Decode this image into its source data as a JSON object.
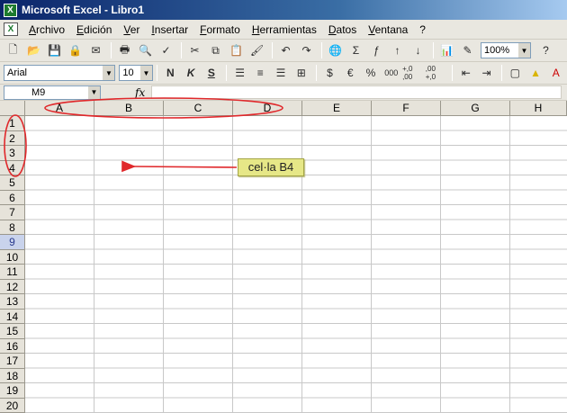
{
  "window": {
    "title": "Microsoft Excel - Libro1"
  },
  "menu": [
    "Archivo",
    "Edición",
    "Ver",
    "Insertar",
    "Formato",
    "Herramientas",
    "Datos",
    "Ventana",
    "?"
  ],
  "toolbar1": {
    "icons": [
      "new-icon",
      "open-icon",
      "save-icon",
      "permission-icon",
      "email-icon",
      "print-icon",
      "print-preview-icon",
      "spelling-icon",
      "cut-icon",
      "copy-icon",
      "paste-icon",
      "format-painter-icon",
      "undo-icon",
      "redo-icon",
      "hyperlink-icon",
      "autosum-icon",
      "function-icon",
      "sort-asc-icon",
      "sort-desc-icon",
      "chart-wizard-icon",
      "drawing-icon",
      "help-icon"
    ],
    "zoom": "100%",
    "sum_glyph": "Σ"
  },
  "toolbar2": {
    "font": "Arial",
    "size": "10",
    "bold": "N",
    "italic": "K",
    "underline": "S",
    "euro": "€",
    "percent": "%",
    "thousands": "000",
    "inc_dec": "+,0 ,00",
    "dec_dec": ",00 +,0"
  },
  "formula": {
    "cell_ref": "M9",
    "fx": "fx"
  },
  "grid": {
    "columns": [
      "A",
      "B",
      "C",
      "D",
      "E",
      "F",
      "G",
      "H"
    ],
    "rows": [
      "1",
      "2",
      "3",
      "4",
      "5",
      "6",
      "7",
      "8",
      "9",
      "10",
      "11",
      "12",
      "13",
      "14",
      "15",
      "16",
      "17",
      "18",
      "19",
      "20"
    ],
    "active_row": "9"
  },
  "annotation": {
    "label": "cel·la B4",
    "color": "#e0282b"
  }
}
